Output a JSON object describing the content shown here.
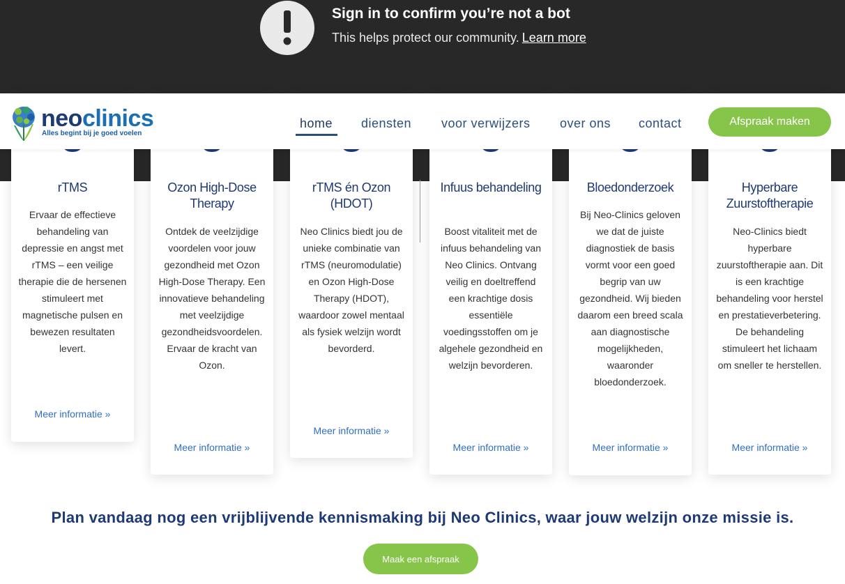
{
  "overlay": {
    "title": "Sign in to confirm you’re not a bot",
    "subtitle": "This helps protect our community.",
    "learn_more": "Learn more",
    "icon": "alert-circle-icon"
  },
  "header": {
    "logo_word_1": "neo",
    "logo_word_2": "clinics",
    "logo_tagline": "Alles begint bij je goed voelen",
    "nav": [
      {
        "label": "home"
      },
      {
        "label": "diensten"
      },
      {
        "label": "voor verwijzers"
      },
      {
        "label": "over ons"
      },
      {
        "label": "contact"
      }
    ],
    "cta_label": "Afspraak maken"
  },
  "services": [
    {
      "title": "rTMS",
      "text": "Ervaar de effectieve behandeling van depressie en angst met rTMS – een veilige therapie die de hersenen stimuleert met magnetische pulsen en bewezen resultaten levert.",
      "link": "Meer informatie »"
    },
    {
      "title": "Ozon High-Dose Therapy",
      "text": "Ontdek de veelzijdige voordelen voor jouw gezondheid met Ozon High-Dose Therapy. Een innovatieve behandeling met veelzijdige gezondheidsvoordelen. Ervaar de kracht van Ozon.",
      "link": "Meer informatie »"
    },
    {
      "title": "rTMS én Ozon (HDOT)",
      "text": "Neo Clinics biedt jou de unieke combinatie van rTMS (neuromodulatie) en Ozon High-Dose Therapy (HDOT), waardoor zowel mentaal als fysiek welzijn wordt bevorderd.",
      "link": "Meer informatie »"
    },
    {
      "title": "Infuus behandeling",
      "text": "Boost vitaliteit met de infuus behandeling van Neo Clinics. Ontvang veilig en doeltreffend een krachtige dosis essentiële voedingsstoffen om je algehele gezondheid en welzijn bevorderen.",
      "link": "Meer informatie »"
    },
    {
      "title": "Bloedonderzoek",
      "text": "Bij Neo-Clinics geloven we dat de juiste diagnostiek de basis vormt voor een goed begrip van uw gezondheid. Wij bieden daarom een breed scala aan diagnostische mogelijkheden, waaronder bloedonderzoek.",
      "link": "Meer informatie »"
    },
    {
      "title": "Hyperbare Zuurstoftherapie",
      "text": "Neo-Clinics biedt hyperbare zuurstoftherapie aan. Dit is een krachtige behandeling voor herstel en prestatieverbetering. De behandeling stimuleert het lichaam om sneller te herstellen.",
      "link": "Meer informatie »"
    }
  ],
  "cta": {
    "tagline": "Plan vandaag nog een vrijblijvende kennismaking bij Neo Clinics, waar jouw welzijn onze missie is.",
    "button": "Maak een afspraak"
  },
  "colors": {
    "brand_navy": "#1e3a73",
    "brand_blue": "#2f6fbf",
    "brand_green": "#86c44a",
    "overlay_bg": "#282828"
  }
}
